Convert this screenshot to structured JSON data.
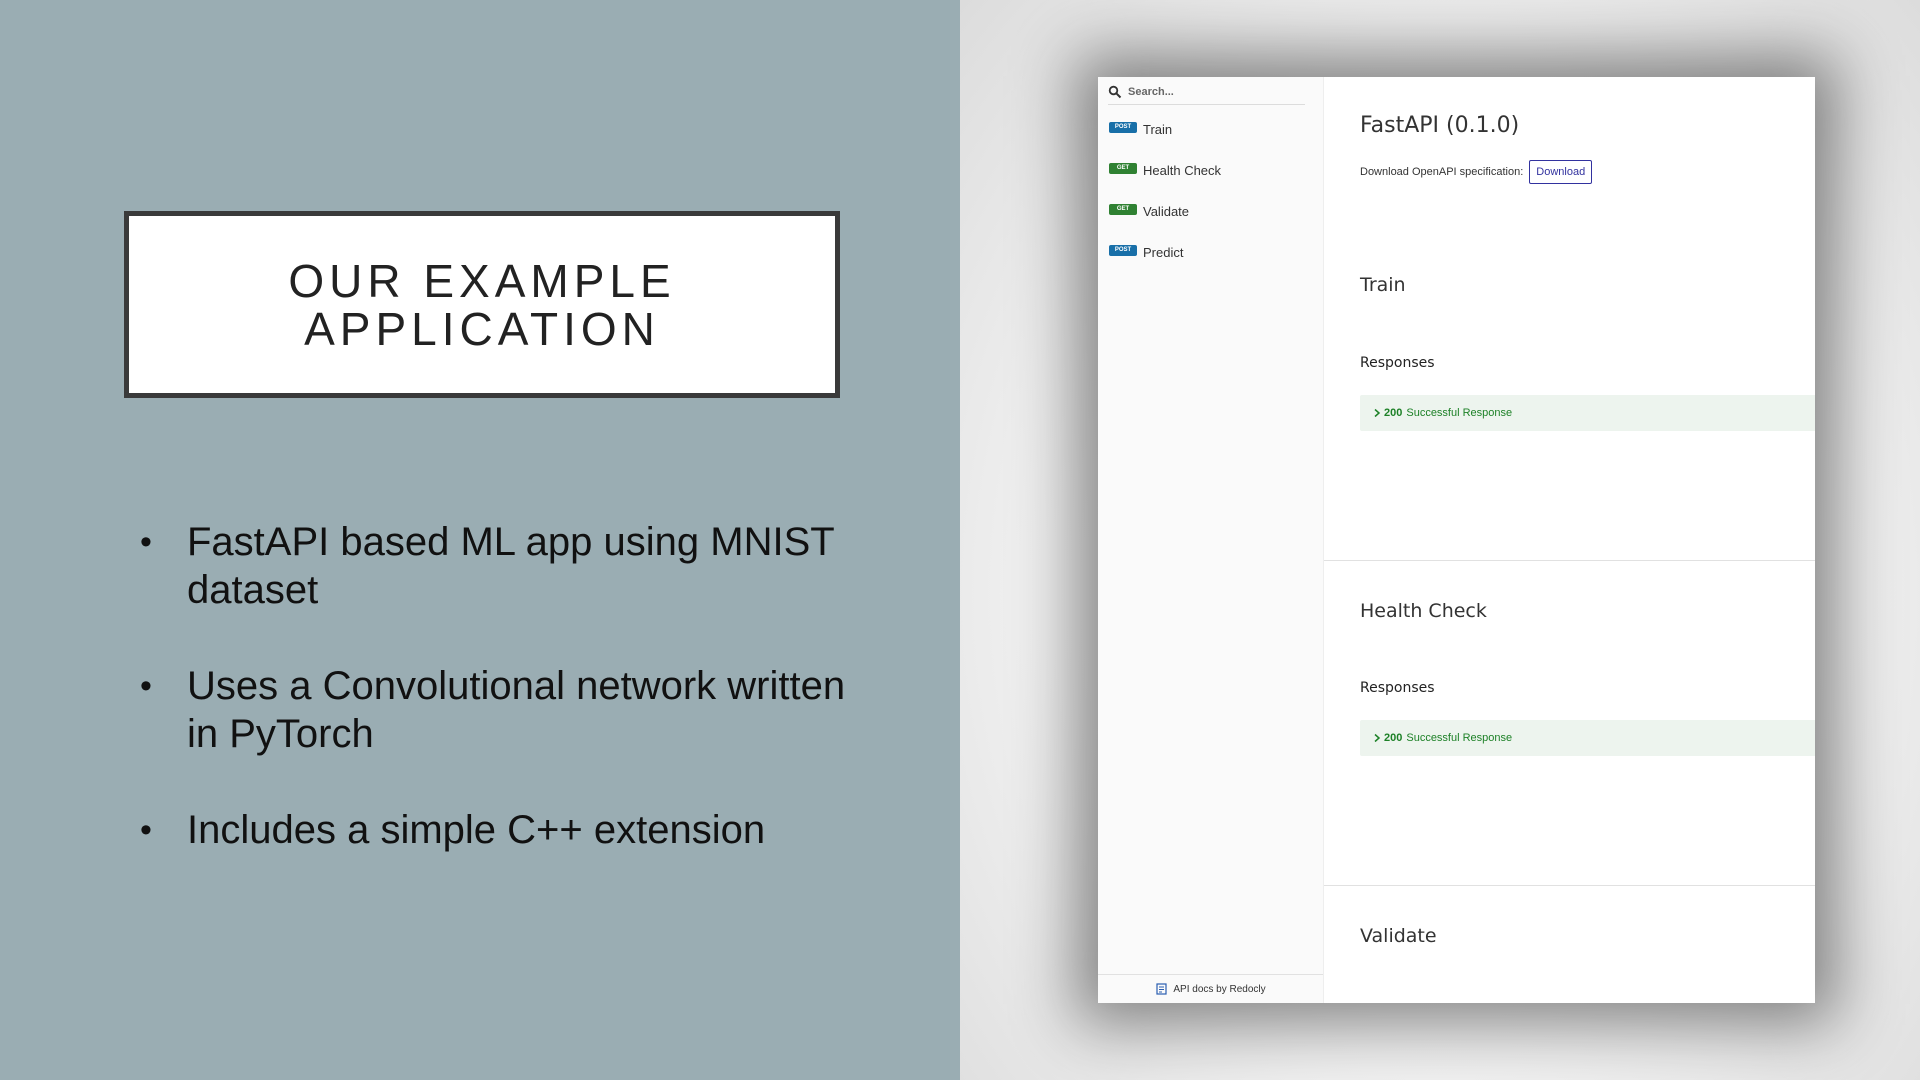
{
  "slide": {
    "title_line1": "OUR EXAMPLE",
    "title_line2": "APPLICATION",
    "bullets": [
      {
        "line1": "FastAPI based ML app using MNIST",
        "line2": "dataset"
      },
      {
        "line1": "Uses a Convolutional network written",
        "line2": "in PyTorch"
      },
      {
        "line1": "Includes a simple C++ extension",
        "line2": ""
      }
    ]
  },
  "colors": {
    "left_bg": "#9aadb3",
    "post_badge": "#186fa8",
    "get_badge": "#2f8132",
    "success_green": "#1d8127"
  },
  "docs": {
    "search": {
      "placeholder": "Search...",
      "icon": "search-icon"
    },
    "nav": [
      {
        "method": "POST",
        "label": "Train"
      },
      {
        "method": "GET",
        "label": "Health Check"
      },
      {
        "method": "GET",
        "label": "Validate"
      },
      {
        "method": "POST",
        "label": "Predict"
      }
    ],
    "footer_label": "API docs by Redocly",
    "api_title": "FastAPI (0.1.0)",
    "download_text": "Download OpenAPI specification:",
    "download_label": "Download",
    "operations": [
      {
        "title": "Train",
        "responses_heading": "Responses",
        "code": "200",
        "description": "Successful Response"
      },
      {
        "title": "Health Check",
        "responses_heading": "Responses",
        "code": "200",
        "description": "Successful Response"
      },
      {
        "title": "Validate"
      }
    ]
  }
}
